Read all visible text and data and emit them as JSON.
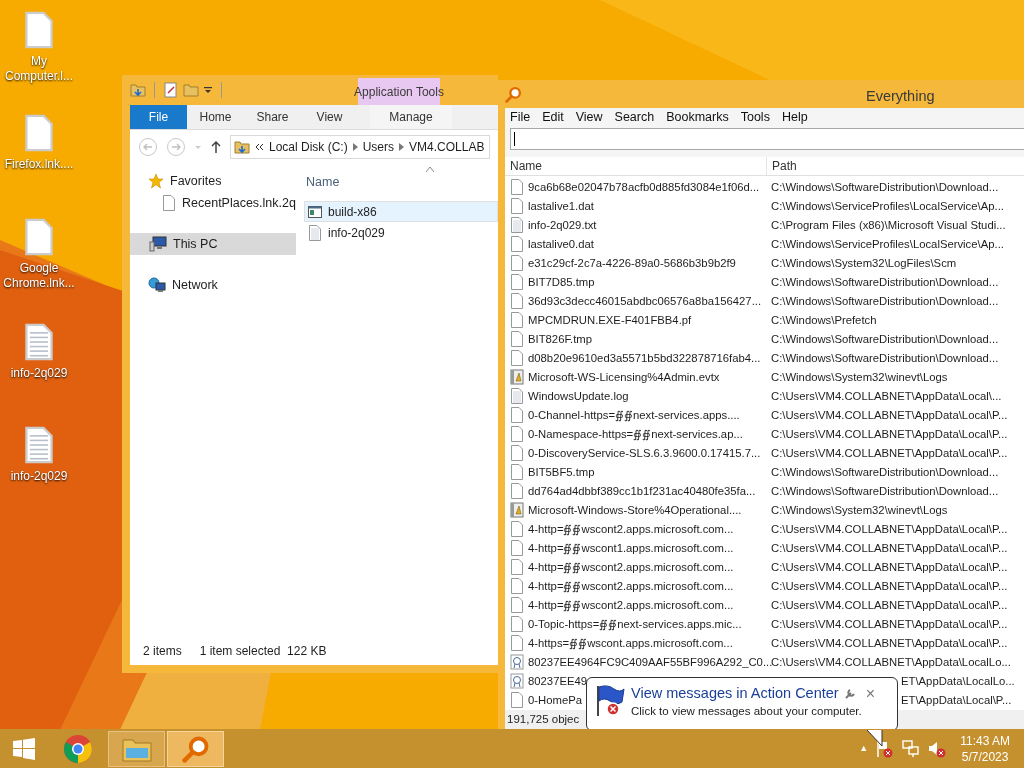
{
  "desktop_icons": [
    {
      "lines": [
        "My",
        "Computer.l..."
      ],
      "kind": "blank"
    },
    {
      "lines": [
        "Firefox.lnk...."
      ],
      "kind": "blank"
    },
    {
      "lines": [
        "Google",
        "Chrome.lnk..."
      ],
      "kind": "blank"
    },
    {
      "lines": [
        "info-2q029"
      ],
      "kind": "text"
    },
    {
      "lines": [
        "info-2q029"
      ],
      "kind": "text"
    }
  ],
  "explorer": {
    "context_group": "Application Tools",
    "tabs": [
      {
        "label": "File",
        "kind": "file"
      },
      {
        "label": "Home",
        "kind": "tab"
      },
      {
        "label": "Share",
        "kind": "tab"
      },
      {
        "label": "View",
        "kind": "tab"
      },
      {
        "label": "Manage",
        "kind": "context"
      }
    ],
    "address": [
      "Local Disk (C:)",
      "Users",
      "VM4.COLLAB"
    ],
    "nav": [
      {
        "label": "Favorites",
        "kind": "favorites",
        "selected": false,
        "children": [
          {
            "label": "RecentPlaces.lnk.2q",
            "kind": "file",
            "selected": false
          }
        ]
      },
      {
        "label": "This PC",
        "kind": "pc",
        "selected": true
      },
      {
        "label": "Network",
        "kind": "network",
        "selected": false
      }
    ],
    "column": "Name",
    "files": [
      {
        "name": "build-x86",
        "kind": "app",
        "selected": true
      },
      {
        "name": "info-2q029",
        "kind": "text",
        "selected": false
      }
    ],
    "status": [
      "2 items",
      "1 item selected  122 KB"
    ]
  },
  "everything": {
    "title": "Everything",
    "menu": [
      "File",
      "Edit",
      "View",
      "Search",
      "Bookmarks",
      "Tools",
      "Help"
    ],
    "columns": [
      "Name",
      "Path"
    ],
    "rows": [
      {
        "name": "9ca6b68e02047b78acfb0d885fd3084e1f06d...",
        "path": "C:\\Windows\\SoftwareDistribution\\Download...",
        "kind": "file"
      },
      {
        "name": "lastalive1.dat",
        "path": "C:\\Windows\\ServiceProfiles\\LocalService\\Ap...",
        "kind": "file"
      },
      {
        "name": "info-2q029.txt",
        "path": "C:\\Program Files (x86)\\Microsoft Visual Studi...",
        "kind": "text"
      },
      {
        "name": "lastalive0.dat",
        "path": "C:\\Windows\\ServiceProfiles\\LocalService\\Ap...",
        "kind": "file"
      },
      {
        "name": "e31c29cf-2c7a-4226-89a0-5686b3b9b2f9",
        "path": "C:\\Windows\\System32\\LogFiles\\Scm",
        "kind": "file"
      },
      {
        "name": "BIT7D85.tmp",
        "path": "C:\\Windows\\SoftwareDistribution\\Download...",
        "kind": "file"
      },
      {
        "name": "36d93c3decc46015abdbc06576a8ba156427...",
        "path": "C:\\Windows\\SoftwareDistribution\\Download...",
        "kind": "file"
      },
      {
        "name": "MPCMDRUN.EXE-F401FBB4.pf",
        "path": "C:\\Windows\\Prefetch",
        "kind": "file"
      },
      {
        "name": "BIT826F.tmp",
        "path": "C:\\Windows\\SoftwareDistribution\\Download...",
        "kind": "file"
      },
      {
        "name": "d08b20e9610ed3a5571b5bd322878716fab4...",
        "path": "C:\\Windows\\SoftwareDistribution\\Download...",
        "kind": "file"
      },
      {
        "name": "Microsoft-WS-Licensing%4Admin.evtx",
        "path": "C:\\Windows\\System32\\winevt\\Logs",
        "kind": "event"
      },
      {
        "name": "WindowsUpdate.log",
        "path": "C:\\Users\\VM4.COLLABNET\\AppData\\Local\\...",
        "kind": "text"
      },
      {
        "name": "0-Channel-https=∯∯next-services.apps....",
        "path": "C:\\Users\\VM4.COLLABNET\\AppData\\Local\\P...",
        "kind": "file"
      },
      {
        "name": "0-Namespace-https=∯∯next-services.ap...",
        "path": "C:\\Users\\VM4.COLLABNET\\AppData\\Local\\P...",
        "kind": "file"
      },
      {
        "name": "0-DiscoveryService-SLS.6.3.9600.0.17415.7...",
        "path": "C:\\Users\\VM4.COLLABNET\\AppData\\Local\\P...",
        "kind": "file"
      },
      {
        "name": "BIT5BF5.tmp",
        "path": "C:\\Windows\\SoftwareDistribution\\Download...",
        "kind": "file"
      },
      {
        "name": "dd764ad4dbbf389cc1b1f231ac40480fe35fa...",
        "path": "C:\\Windows\\SoftwareDistribution\\Download...",
        "kind": "file"
      },
      {
        "name": "Microsoft-Windows-Store%4Operational....",
        "path": "C:\\Windows\\System32\\winevt\\Logs",
        "kind": "event"
      },
      {
        "name": "4-http=∯∯wscont2.apps.microsoft.com...",
        "path": "C:\\Users\\VM4.COLLABNET\\AppData\\Local\\P...",
        "kind": "file"
      },
      {
        "name": "4-http=∯∯wscont1.apps.microsoft.com...",
        "path": "C:\\Users\\VM4.COLLABNET\\AppData\\Local\\P...",
        "kind": "file"
      },
      {
        "name": "4-http=∯∯wscont2.apps.microsoft.com...",
        "path": "C:\\Users\\VM4.COLLABNET\\AppData\\Local\\P...",
        "kind": "file"
      },
      {
        "name": "4-http=∯∯wscont2.apps.microsoft.com...",
        "path": "C:\\Users\\VM4.COLLABNET\\AppData\\Local\\P...",
        "kind": "file"
      },
      {
        "name": "4-http=∯∯wscont2.apps.microsoft.com...",
        "path": "C:\\Users\\VM4.COLLABNET\\AppData\\Local\\P...",
        "kind": "file"
      },
      {
        "name": "0-Topic-https=∯∯next-services.apps.mic...",
        "path": "C:\\Users\\VM4.COLLABNET\\AppData\\Local\\P...",
        "kind": "file"
      },
      {
        "name": "4-https=∯∯wscont.apps.microsoft.com...",
        "path": "C:\\Users\\VM4.COLLABNET\\AppData\\Local\\P...",
        "kind": "file"
      },
      {
        "name": "80237EE4964FC9C409AAF55BF996A292_C0...",
        "path": "C:\\Users\\VM4.COLLABNET\\AppData\\LocalLo...",
        "kind": "cert"
      },
      {
        "name": "80237EE49",
        "path": "ET\\AppData\\LocalLo...",
        "kind": "cert",
        "covered": true
      },
      {
        "name": "0-HomePa",
        "path": "ET\\AppData\\Local\\P...",
        "kind": "file",
        "covered": true
      }
    ],
    "status": "191,725 objec"
  },
  "balloon": {
    "title": "View messages in Action Center",
    "text": "Click to view messages about your computer.",
    "close": "×"
  },
  "taskbar": {
    "apps": [
      {
        "kind": "chrome",
        "running": false
      },
      {
        "kind": "explorer",
        "running": true
      },
      {
        "kind": "everything",
        "running": true
      }
    ],
    "tray_arrow": "▲",
    "time": "11:43 AM",
    "date": "5/7/2023"
  }
}
